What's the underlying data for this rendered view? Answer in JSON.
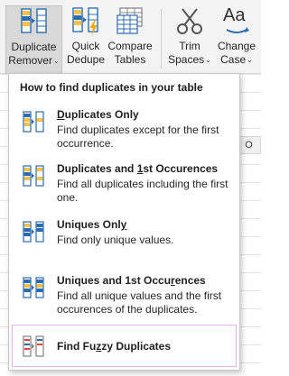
{
  "ribbon": {
    "buttons": [
      {
        "line1": "Duplicate",
        "line2": "Remover",
        "has_dropdown": true,
        "icon": "duplicate-remover-icon"
      },
      {
        "line1": "Quick",
        "line2": "Dedupe",
        "has_dropdown": false,
        "icon": "quick-dedupe-icon"
      },
      {
        "line1": "Compare",
        "line2": "Tables",
        "has_dropdown": false,
        "icon": "compare-tables-icon"
      },
      {
        "line1": "Trim",
        "line2": "Spaces",
        "has_dropdown": true,
        "icon": "scissors-icon"
      },
      {
        "line1": "Change",
        "line2": "Case",
        "has_dropdown": true,
        "icon": "change-case-icon"
      }
    ],
    "dropdown_glyph": "⌄",
    "change_case_glyph": "Aa"
  },
  "grid": {
    "column_letter": "O"
  },
  "menu": {
    "title": "How to find duplicates in your table",
    "items": [
      {
        "label_pre": "",
        "label_u": "D",
        "label_post": "uplicates Only",
        "desc": "Find duplicates except for the first occurrence."
      },
      {
        "label_pre": "Duplicates and ",
        "label_u": "1",
        "label_post": "st Occurences",
        "desc": "Find all duplicates including the first one."
      },
      {
        "label_pre": "Uniques Onl",
        "label_u": "y",
        "label_post": "",
        "desc": "Find only unique values."
      },
      {
        "label_pre": "Uniques and 1st Occu",
        "label_u": "r",
        "label_post": "ences",
        "desc": "Find all unique values and the first occurences of the duplicates."
      },
      {
        "label_pre": "Find Fu",
        "label_u": "z",
        "label_post": "zy Duplicates",
        "desc": ""
      }
    ]
  },
  "colors": {
    "icon_blue": "#2b6cb0",
    "icon_yellow": "#f2c14e",
    "icon_red": "#e04a3a",
    "icon_gray": "#808080",
    "highlight_border": "#e3b3ee"
  }
}
